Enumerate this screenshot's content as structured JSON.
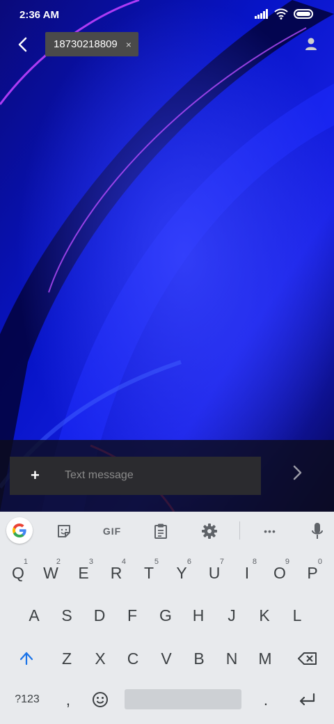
{
  "status_bar": {
    "time": "2:36 AM"
  },
  "header": {
    "recipient": "18730218809",
    "remove_symbol": "×"
  },
  "composer": {
    "attach_label": "+",
    "placeholder": "Text message"
  },
  "keyboard": {
    "toolbar": {
      "gif_label": "GIF",
      "more_label": "•••"
    },
    "row1": [
      {
        "label": "Q",
        "hint": "1"
      },
      {
        "label": "W",
        "hint": "2"
      },
      {
        "label": "E",
        "hint": "3"
      },
      {
        "label": "R",
        "hint": "4"
      },
      {
        "label": "T",
        "hint": "5"
      },
      {
        "label": "Y",
        "hint": "6"
      },
      {
        "label": "U",
        "hint": "7"
      },
      {
        "label": "I",
        "hint": "8"
      },
      {
        "label": "O",
        "hint": "9"
      },
      {
        "label": "P",
        "hint": "0"
      }
    ],
    "row2": [
      "A",
      "S",
      "D",
      "F",
      "G",
      "H",
      "J",
      "K",
      "L"
    ],
    "row3": [
      "Z",
      "X",
      "C",
      "V",
      "B",
      "N",
      "M"
    ],
    "row4": {
      "symbols_label": "?123",
      "comma": ",",
      "period": "."
    }
  },
  "colors": {
    "keyboard_bg": "#e8eaed",
    "accent": "#1a73e8",
    "wallpaper": "#0a16d8"
  }
}
